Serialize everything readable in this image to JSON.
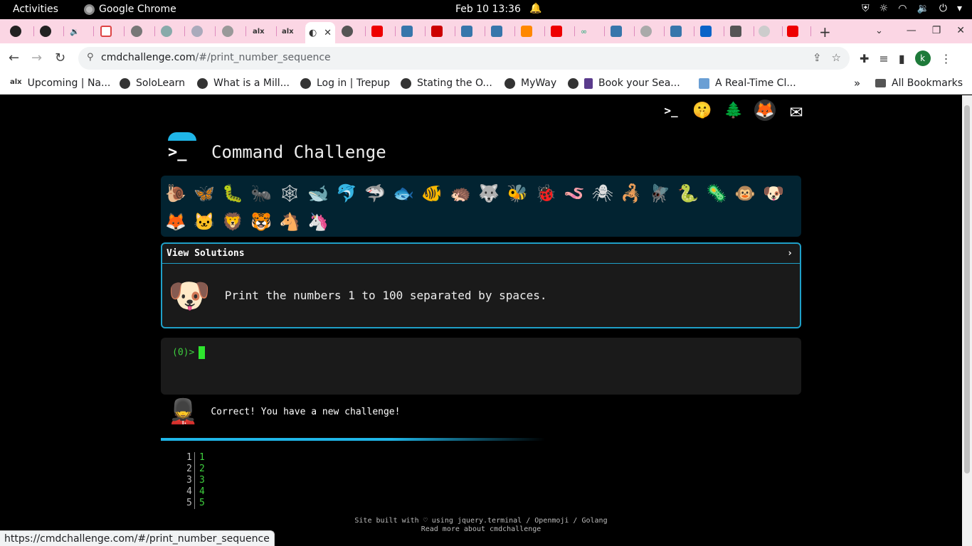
{
  "system": {
    "activities": "Activities",
    "app_name": "Google Chrome",
    "clock": "Feb 10  13:36"
  },
  "browser": {
    "url_domain": "cmdchallenge.com",
    "url_path": "/#/print_number_sequence",
    "avatar_letter": "k",
    "status_url": "https://cmdchallenge.com/#/print_number_sequence",
    "bookmarks": [
      {
        "label": "Upcoming | Na..."
      },
      {
        "label": "SoloLearn"
      },
      {
        "label": "What is a Mill..."
      },
      {
        "label": "Log in | Trepup"
      },
      {
        "label": "Stating the O..."
      },
      {
        "label": "MyWay"
      },
      {
        "label": "Book your Sea..."
      },
      {
        "label": "A Real-Time Cl..."
      }
    ],
    "all_bookmarks": "All Bookmarks"
  },
  "page": {
    "title": "Command Challenge",
    "view_solutions": "View Solutions",
    "chevron": "›",
    "challenge_text": "Print the numbers 1 to 100 separated by spaces.",
    "prompt": "(0)>",
    "feedback": "Correct! You have a new challenge!",
    "output": [
      {
        "line": "1",
        "value": "1"
      },
      {
        "line": "2",
        "value": "2"
      },
      {
        "line": "3",
        "value": "3"
      },
      {
        "line": "4",
        "value": "4"
      },
      {
        "line": "5",
        "value": "5"
      }
    ],
    "footer_line1": "Site built with ♡ using jquery.terminal / Openmoji / Golang",
    "footer_line2": "Read more about cmdchallenge"
  },
  "colors": {
    "accent": "#1fb6e8",
    "prompt_green": "#3ecf3e",
    "tabstrip_pink": "#fbd6e4"
  }
}
